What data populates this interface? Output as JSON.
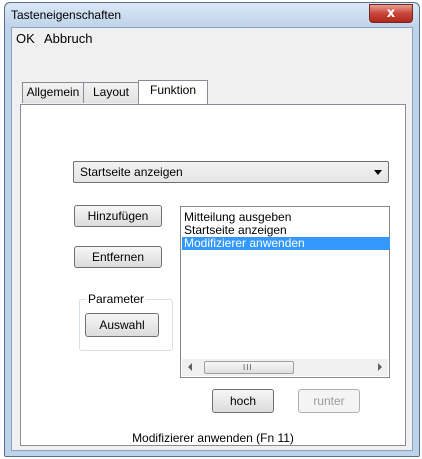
{
  "window": {
    "title": "Tasteneigenschaften",
    "close_glyph": "x"
  },
  "menu": [
    "OK",
    "Abbruch"
  ],
  "tabs": [
    {
      "label": "Allgemein",
      "active": false
    },
    {
      "label": "Layout",
      "active": false
    },
    {
      "label": "Funktion",
      "active": true
    }
  ],
  "function_panel": {
    "combo_value": "Startseite anzeigen",
    "buttons": {
      "add": "Hinzufügen",
      "remove": "Entfernen",
      "select": "Auswahl",
      "up": "hoch",
      "down": "runter"
    },
    "group_label": "Parameter",
    "list_items": [
      {
        "label": "Mitteilung ausgeben",
        "selected": false
      },
      {
        "label": "Startseite anzeigen",
        "selected": false
      },
      {
        "label": "Modifizierer anwenden",
        "selected": true
      }
    ],
    "scroll_grip": "III",
    "status_text": "Modifizierer anwenden (Fn 11)"
  },
  "colors": {
    "selection": "#3399ff",
    "close_button": "#c8443a"
  }
}
